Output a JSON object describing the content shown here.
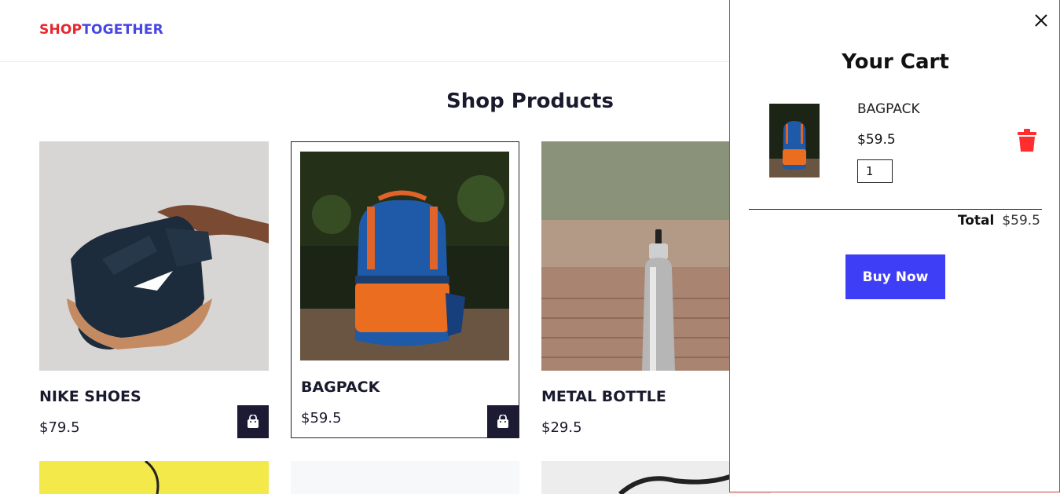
{
  "header": {
    "logo_part1": "SHOP",
    "logo_part2": "TOGETHER"
  },
  "main": {
    "title": "Shop Products"
  },
  "products": [
    {
      "name": "NIKE SHOES",
      "price": "$79.5"
    },
    {
      "name": "BAGPACK",
      "price": "$59.5"
    },
    {
      "name": "METAL BOTTLE",
      "price": "$29.5"
    }
  ],
  "cart": {
    "title": "Your Cart",
    "item": {
      "name": "BAGPACK",
      "price": "$59.5",
      "quantity": "1"
    },
    "total_label": "Total",
    "total_value": "$59.5",
    "buy_label": "Buy Now"
  },
  "colors": {
    "logo_red": "#e8262e",
    "logo_blue": "#4646e6",
    "accent": "#3f3ef7",
    "delete_red": "#ff2d2d",
    "dark": "#1d1a33"
  },
  "icons": {
    "cart_close": "close-icon",
    "add_to_cart": "shopping-bag-icon",
    "delete": "trash-icon"
  }
}
